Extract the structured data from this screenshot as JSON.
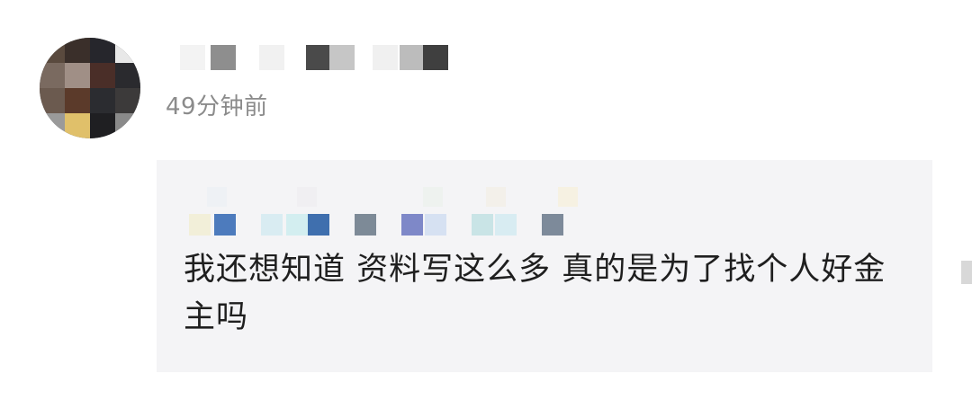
{
  "post": {
    "timestamp": "49分钟前",
    "comment": "我还想知道 资料写这么多 真的是为了找个人好金主吗"
  },
  "colors": {
    "bubble_bg": "#f4f4f6",
    "text": "#1f1f1f",
    "timestamp": "#8b8b8b"
  },
  "icons": [
    "avatar-censored",
    "username-censored",
    "quoted-text-censored"
  ]
}
